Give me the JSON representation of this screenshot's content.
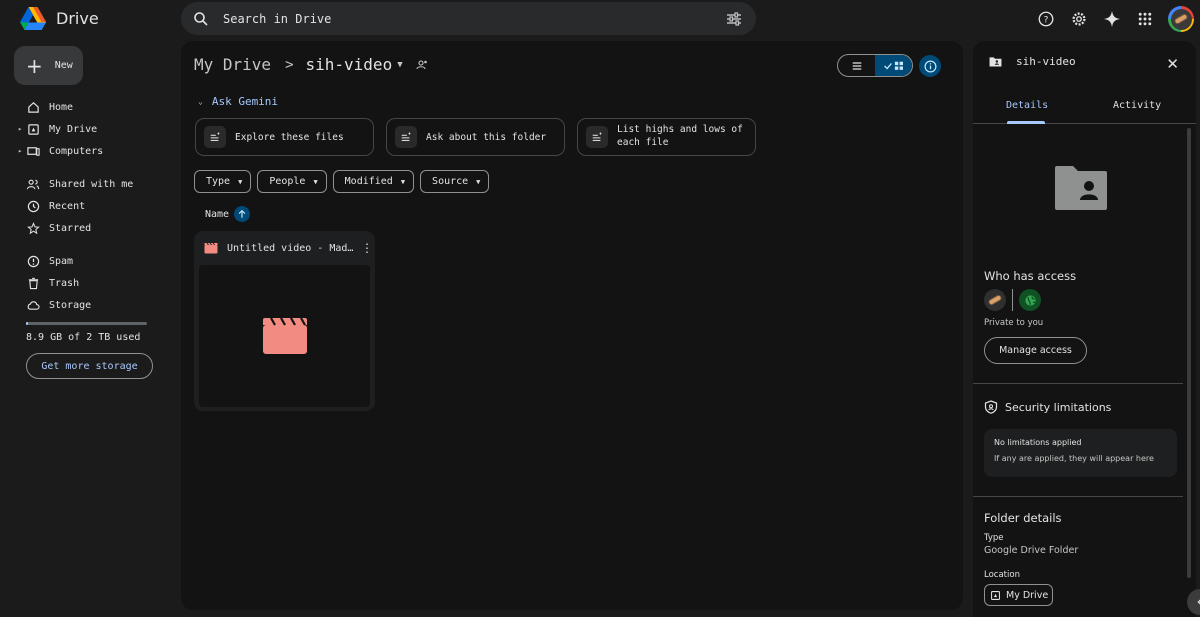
{
  "app": {
    "name": "Drive"
  },
  "search": {
    "placeholder": "Search in Drive"
  },
  "sidebar": {
    "new_label": "New",
    "items": [
      {
        "label": "Home"
      },
      {
        "label": "My Drive"
      },
      {
        "label": "Computers"
      },
      {
        "label": "Shared with me"
      },
      {
        "label": "Recent"
      },
      {
        "label": "Starred"
      },
      {
        "label": "Spam"
      },
      {
        "label": "Trash"
      },
      {
        "label": "Storage"
      }
    ],
    "storage_used_text": "8.9 GB of 2 TB used",
    "storage_fraction": 0.0044,
    "get_storage_label": "Get more storage"
  },
  "main": {
    "breadcrumb_root": "My Drive",
    "breadcrumb_current": "sih-video",
    "gemini_label": "Ask Gemini",
    "suggestions": [
      {
        "label": "Explore these files"
      },
      {
        "label": "Ask about this folder"
      },
      {
        "label": "List highs and lows of each file"
      }
    ],
    "filters": [
      {
        "label": "Type"
      },
      {
        "label": "People"
      },
      {
        "label": "Modified"
      },
      {
        "label": "Source"
      }
    ],
    "sort_label": "Name",
    "files": [
      {
        "name": "Untitled video - Mad…",
        "type": "video"
      }
    ]
  },
  "details": {
    "folder_name": "sih-video",
    "tabs": [
      "Details",
      "Activity"
    ],
    "active_tab": "Details",
    "who_has_access_title": "Who has access",
    "access_text": "Private to you",
    "manage_access_label": "Manage access",
    "security_title": "Security limitations",
    "limitations_line1": "No limitations applied",
    "limitations_line2": "If any are applied, they will appear here",
    "folder_details_title": "Folder details",
    "type_label": "Type",
    "type_value": "Google Drive Folder",
    "location_label": "Location",
    "location_value": "My Drive"
  },
  "colors": {
    "background": "#1b1b1b",
    "panel": "#131314",
    "accent": "#a8c7fa",
    "accent_fill": "#004a77",
    "video_icon": "#f28b82"
  }
}
